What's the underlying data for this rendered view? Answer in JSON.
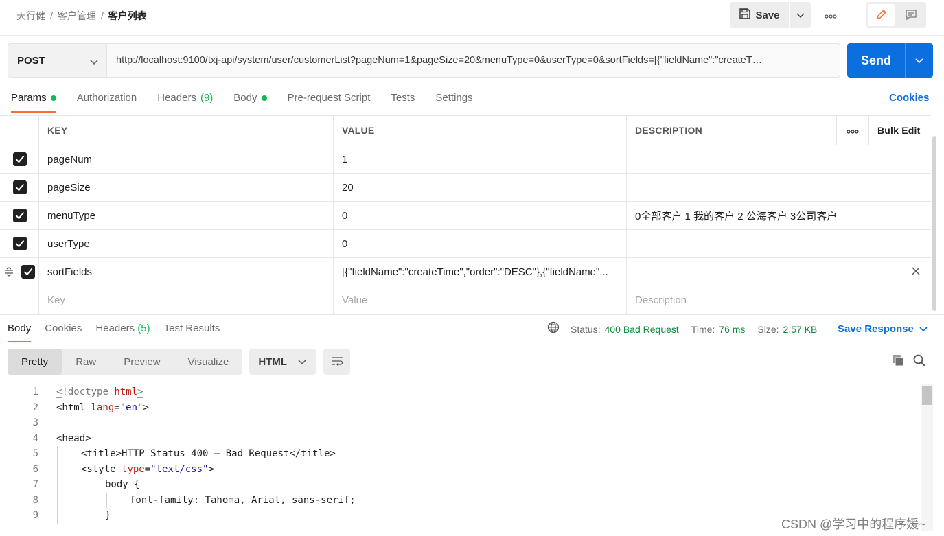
{
  "breadcrumb": {
    "items": [
      "天行健",
      "客户管理"
    ],
    "separator": "/",
    "current": "客户列表"
  },
  "toolbar": {
    "save_label": "Save"
  },
  "request": {
    "method": "POST",
    "url": "http://localhost:9100/txj-api/system/user/customerList?pageNum=1&pageSize=20&menuType=0&userType=0&sortFields=[{\"fieldName\":\"createT…",
    "send_label": "Send"
  },
  "request_tabs": [
    {
      "label": "Params",
      "active": true,
      "dot": true
    },
    {
      "label": "Authorization"
    },
    {
      "label": "Headers",
      "count": "(9)"
    },
    {
      "label": "Body",
      "dot": true
    },
    {
      "label": "Pre-request Script"
    },
    {
      "label": "Tests"
    },
    {
      "label": "Settings"
    }
  ],
  "cookies_label": "Cookies",
  "params": {
    "headers": {
      "key": "KEY",
      "value": "VALUE",
      "description": "DESCRIPTION",
      "bulk_edit": "Bulk Edit"
    },
    "rows": [
      {
        "key": "pageNum",
        "value": "1",
        "description": "",
        "checked": true
      },
      {
        "key": "pageSize",
        "value": "20",
        "description": "",
        "checked": true
      },
      {
        "key": "menuType",
        "value": "0",
        "description": "0全部客户 1 我的客户 2 公海客户 3公司客户",
        "checked": true
      },
      {
        "key": "userType",
        "value": "0",
        "description": "",
        "checked": true
      },
      {
        "key": "sortFields",
        "value": "[{\"fieldName\":\"createTime\",\"order\":\"DESC\"},{\"fieldName\"...",
        "description": "",
        "checked": true
      }
    ],
    "placeholders": {
      "key": "Key",
      "value": "Value",
      "description": "Description"
    }
  },
  "response": {
    "tabs": [
      {
        "label": "Body",
        "active": true
      },
      {
        "label": "Cookies"
      },
      {
        "label": "Headers",
        "count": "(5)"
      },
      {
        "label": "Test Results"
      }
    ],
    "status_label": "Status:",
    "status_value": "400 Bad Request",
    "time_label": "Time:",
    "time_value": "76 ms",
    "size_label": "Size:",
    "size_value": "2.57 KB",
    "save_response_label": "Save Response",
    "views": [
      "Pretty",
      "Raw",
      "Preview",
      "Visualize"
    ],
    "active_view": "Pretty",
    "language": "HTML"
  },
  "code_lines": [
    {
      "n": "1"
    },
    {
      "n": "2"
    },
    {
      "n": "3"
    },
    {
      "n": "4"
    },
    {
      "n": "5"
    },
    {
      "n": "6"
    },
    {
      "n": "7"
    },
    {
      "n": "8"
    },
    {
      "n": "9"
    }
  ],
  "code": {
    "l1_open": "<",
    "l1_doctype": "!doctype",
    "l1_html": "html",
    "l1_close": ">",
    "l2_open": "<html ",
    "l2_attr": "lang",
    "l2_eq": "=",
    "l2_val": "\"en\"",
    "l2_close": ">",
    "l4": "<head>",
    "l5": "<title>HTTP Status 400 – Bad Request</title>",
    "l6_open": "<style ",
    "l6_attr": "type",
    "l6_eq": "=",
    "l6_val": "\"text/css\"",
    "l6_close": ">",
    "l7": "body {",
    "l8": "font-family: Tahoma, Arial, sans-serif;",
    "l9": "}"
  },
  "watermark": "CSDN @学习中的程序媛~",
  "colors": {
    "accent_orange": "#ff6c37",
    "send_blue": "#0c6fe0",
    "status_green": "#0f8c3e",
    "dot_green": "#0cbb52"
  },
  "icons": [
    "save-icon",
    "chevron-down-icon",
    "more-icon",
    "edit-pencil-icon",
    "comment-icon",
    "checkbox-checked-icon",
    "drag-handle-icon",
    "close-icon",
    "globe-icon",
    "wrap-lines-icon",
    "copy-icon",
    "search-icon"
  ]
}
